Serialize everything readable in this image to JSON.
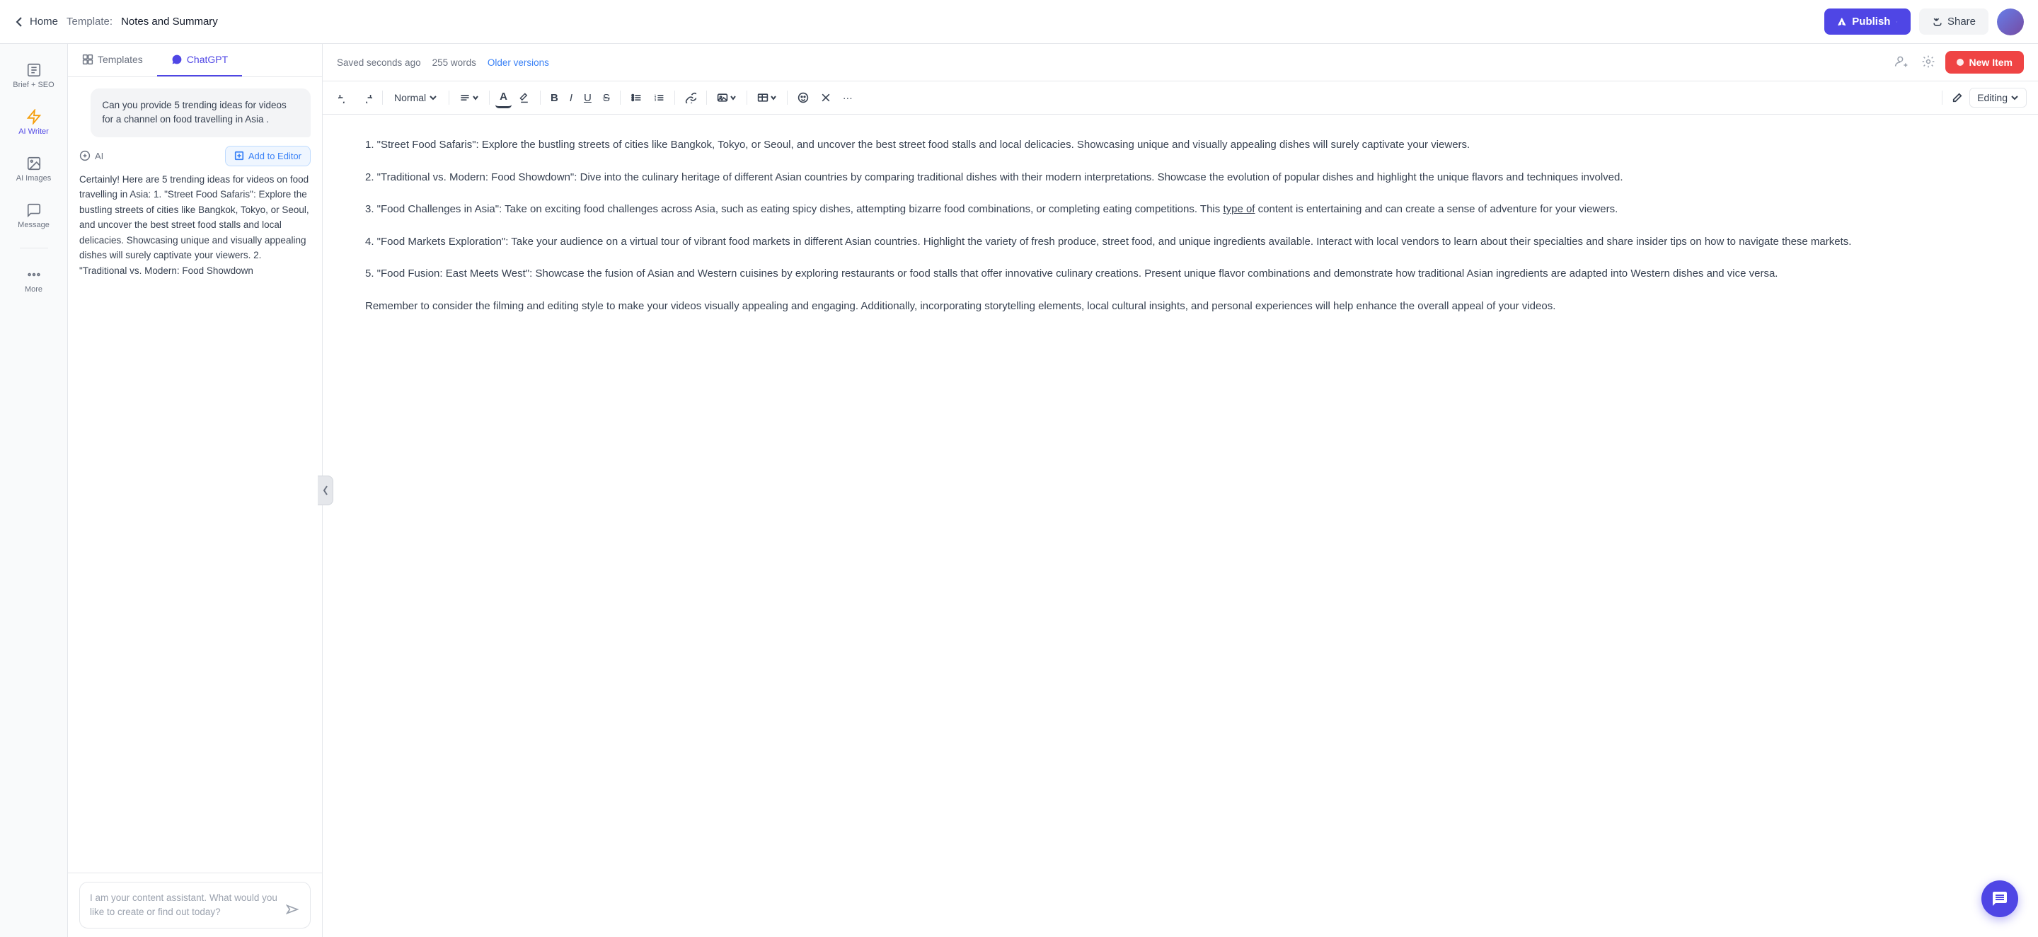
{
  "header": {
    "home_label": "Home",
    "template_prefix": "Template:",
    "template_name": "Notes and Summary",
    "publish_label": "Publish",
    "share_label": "Share"
  },
  "sidebar": {
    "items": [
      {
        "id": "brief-seo",
        "label": "Brief + SEO",
        "icon": "briefcase"
      },
      {
        "id": "ai-writer",
        "label": "AI Writer",
        "icon": "lightning",
        "active": true
      },
      {
        "id": "ai-images",
        "label": "AI Images",
        "icon": "image"
      },
      {
        "id": "message",
        "label": "Message",
        "icon": "message"
      },
      {
        "id": "more",
        "label": "More",
        "icon": "more"
      }
    ]
  },
  "chat_panel": {
    "tabs": [
      {
        "id": "templates",
        "label": "Templates",
        "icon": "grid"
      },
      {
        "id": "chatgpt",
        "label": "ChatGPT",
        "icon": "chat",
        "active": true
      }
    ],
    "user_message": "Can you provide 5 trending ideas for videos for a channel on food travelling in Asia\n.",
    "ai_label": "AI",
    "add_to_editor_label": "Add to Editor",
    "ai_response": "Certainly! Here are 5 trending ideas for videos on food travelling in Asia:\n\n1. \"Street Food Safaris\": Explore the bustling streets of cities like Bangkok, Tokyo, or Seoul, and uncover the best street food stalls and local delicacies. Showcasing unique and visually appealing dishes will surely captivate your viewers.\n\n2. \"Traditional vs. Modern: Food Showdown",
    "input_placeholder": "I am your content assistant. What would you like to create or find out today?"
  },
  "editor": {
    "status": "Saved seconds ago",
    "word_count": "255 words",
    "older_versions": "Older versions",
    "new_item_label": "New Item",
    "style_label": "Normal",
    "editing_label": "Editing",
    "content": {
      "p1": "1. \"Street Food Safaris\": Explore the bustling streets of cities like Bangkok, Tokyo, or Seoul, and uncover the best street food stalls and local delicacies. Showcasing unique and visually appealing dishes will surely captivate your viewers.",
      "p2": "2. \"Traditional vs. Modern: Food Showdown\": Dive into the culinary heritage of different Asian countries by comparing traditional dishes with their modern interpretations. Showcase the evolution of popular dishes and highlight the unique flavors and techniques involved.",
      "p3": "3. \"Food Challenges in Asia\": Take on exciting food challenges across Asia, such as eating spicy dishes, attempting bizarre food combinations, or completing eating competitions. This type of content is entertaining and can create a sense of adventure for your viewers.",
      "p4": "4. \"Food Markets Exploration\": Take your audience on a virtual tour of vibrant food markets in different Asian countries. Highlight the variety of fresh produce, street food, and unique ingredients available. Interact with local vendors to learn about their specialties and share insider tips on how to navigate these markets.",
      "p5": "5. \"Food Fusion: East Meets West\": Showcase the fusion of Asian and Western cuisines by exploring restaurants or food stalls that offer innovative culinary creations. Present unique flavor combinations and demonstrate how traditional Asian ingredients are adapted into Western dishes and vice versa.",
      "p6": "Remember to consider the filming and editing style to make your videos visually appealing and engaging. Additionally, incorporating storytelling elements, local cultural insights, and personal experiences will help enhance the overall appeal of your videos."
    }
  }
}
